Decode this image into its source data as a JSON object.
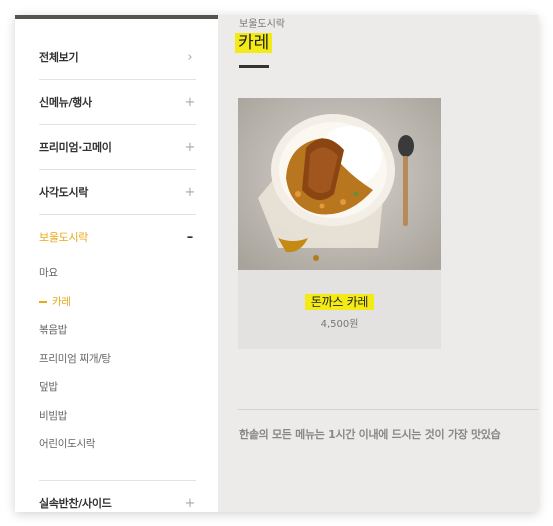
{
  "sidebar": {
    "categories": [
      {
        "label": "전체보기",
        "icon": "chevron-right-icon",
        "glyph": "›"
      },
      {
        "label": "신메뉴/행사",
        "icon": "plus-icon",
        "glyph": "+"
      },
      {
        "label": "프리미엄·고메이",
        "icon": "plus-icon",
        "glyph": "+"
      },
      {
        "label": "사각도시락",
        "icon": "plus-icon",
        "glyph": "+"
      },
      {
        "label": "보울도시락",
        "icon": "minus-icon",
        "glyph": "–"
      }
    ],
    "subitems": [
      "마요",
      "카레",
      "볶음밥",
      "프리미엄 찌개/탕",
      "덮밥",
      "비빔밥",
      "어린이도시락"
    ],
    "active_sub": "카레",
    "bottom_category": {
      "label": "실속반찬/사이드",
      "icon": "plus-icon",
      "glyph": "+"
    }
  },
  "main": {
    "breadcrumb": "보울도시락",
    "title": "카레",
    "product": {
      "name": "돈까스 카레",
      "price": "4,500원"
    },
    "notice": "한솥의 모든 메뉴는 1시간 이내에 드시는 것이 가장 맛있습"
  },
  "colors": {
    "accent": "#e8a91b",
    "highlight": "#f3ea16",
    "panel": "#edebea"
  }
}
